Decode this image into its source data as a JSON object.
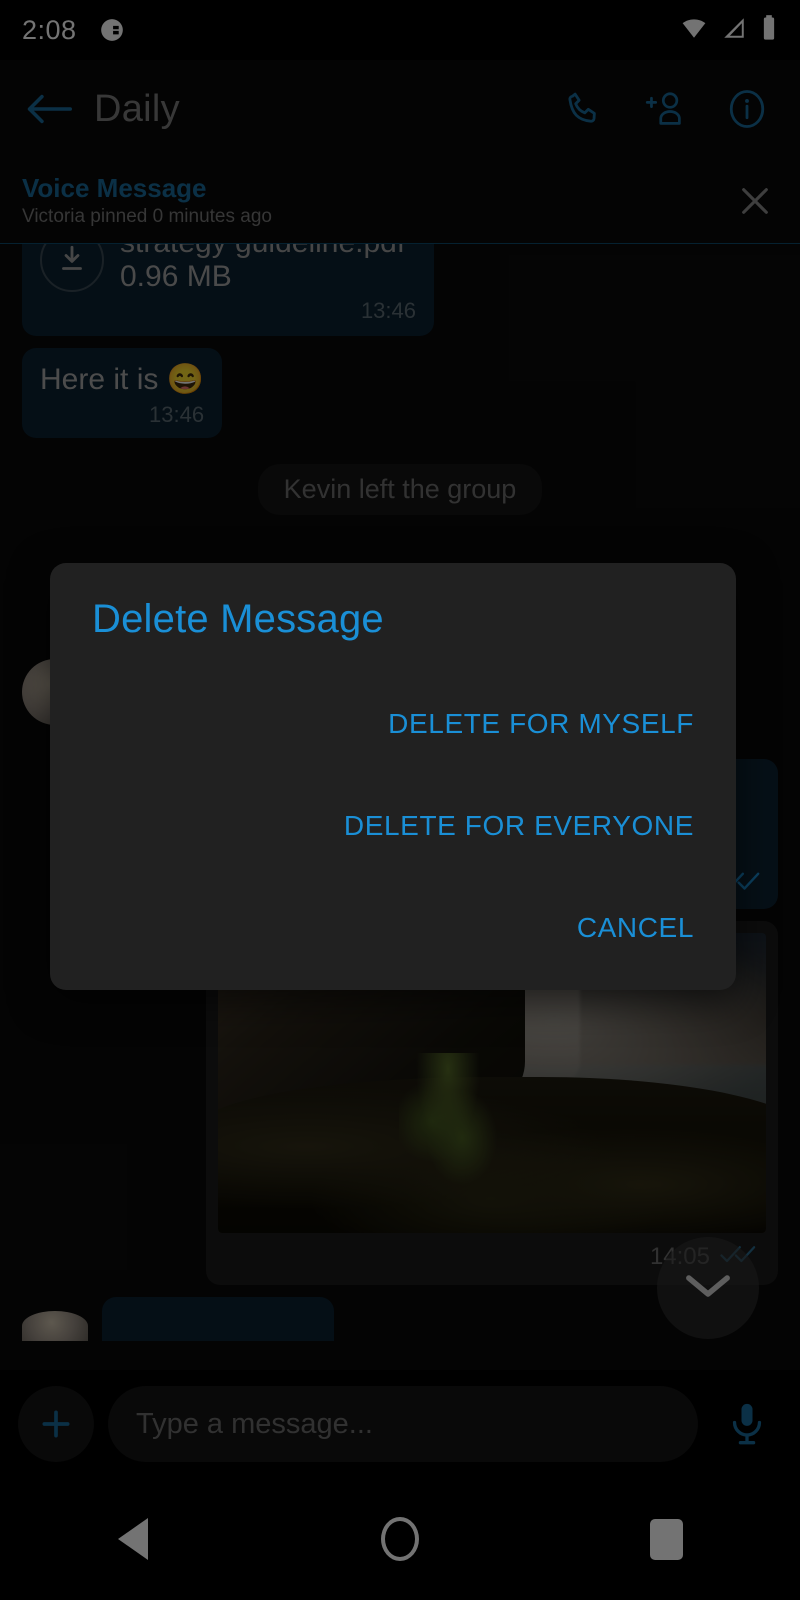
{
  "status_bar": {
    "time": "2:08",
    "app_icon": "app-notification-icon",
    "icons": [
      "wifi-icon",
      "signal-icon",
      "battery-icon"
    ]
  },
  "app_bar": {
    "back_icon": "back-arrow-icon",
    "title": "Daily",
    "actions": [
      {
        "name": "call-icon",
        "label": "Call"
      },
      {
        "name": "add-person-icon",
        "label": "Add participant"
      },
      {
        "name": "info-icon",
        "label": "Info"
      }
    ]
  },
  "pinned_banner": {
    "title": "Voice Message",
    "subtitle": "Victoria pinned 0 minutes ago",
    "close_icon": "close-icon"
  },
  "messages": [
    {
      "kind": "file",
      "icon": "download-icon",
      "file_name": "strategy guideline.pdf",
      "file_size": "0.96 MB",
      "time": "13:46",
      "side": "in"
    },
    {
      "kind": "text",
      "text": "Here it is 😄",
      "time": "13:46",
      "side": "in"
    },
    {
      "kind": "system",
      "text": "Kevin left the group"
    },
    {
      "kind": "photo",
      "alt": "Waterfall over mossy cliff at dusk",
      "time": "14:05",
      "status_icon": "double-check-icon",
      "side": "out"
    }
  ],
  "scroll_fab": {
    "icon": "chevron-down-icon"
  },
  "composer": {
    "attach_icon": "plus-icon",
    "placeholder": "Type a message...",
    "value": "",
    "mic_icon": "microphone-icon"
  },
  "dialog": {
    "title": "Delete Message",
    "buttons": [
      {
        "name": "delete-for-myself-button",
        "label": "DELETE FOR MYSELF"
      },
      {
        "name": "delete-for-everyone-button",
        "label": "DELETE FOR EVERYONE"
      },
      {
        "name": "cancel-button",
        "label": "CANCEL"
      }
    ]
  },
  "nav_bar": {
    "back": "nav-back-icon",
    "home": "nav-home-icon",
    "recents": "nav-recents-icon"
  },
  "colors": {
    "accent_blue": "#1a8fd6",
    "dim_blue": "#1a6c9c",
    "dialog_bg": "#212121",
    "bubble_in": "#0c2232",
    "screen_bg": "#0a0a0a"
  }
}
